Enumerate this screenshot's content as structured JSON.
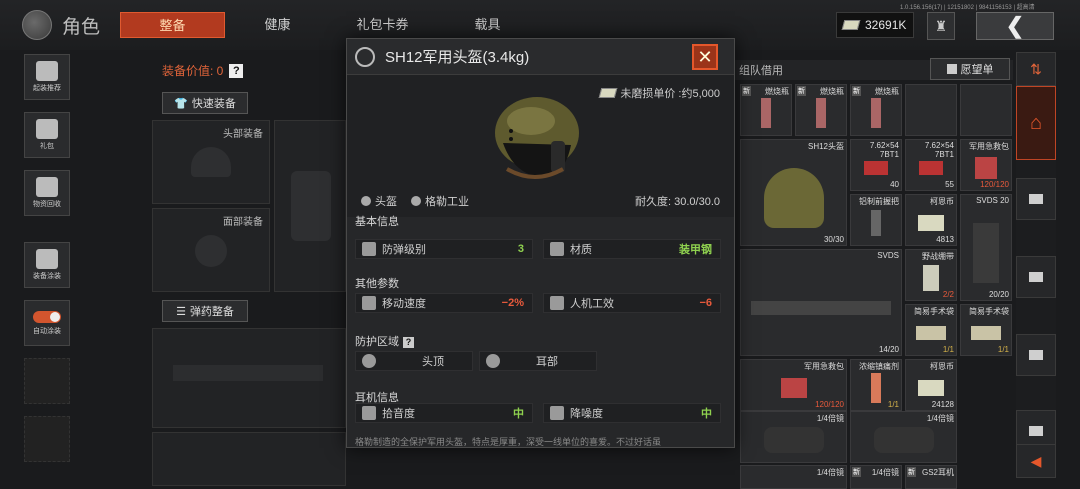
{
  "header": {
    "title": "角色",
    "tabs": [
      "整备",
      "健康",
      "礼包卡券",
      "载具"
    ],
    "version": "1.0.156.156(17) | 12151802 | 9841156153 | 超高清",
    "currency": "32691K"
  },
  "sidebar": {
    "items": [
      {
        "label": "起装推荐",
        "icon": "helmet-sparkle-icon"
      },
      {
        "label": "礼包",
        "icon": "gift-icon"
      },
      {
        "label": "物资回收",
        "icon": "recycle-icon"
      },
      {
        "label": "装备涂装",
        "icon": "spray-icon"
      },
      {
        "label": "自动涂装",
        "icon": "toggle-icon"
      }
    ]
  },
  "equipment": {
    "value_label": "装备价值: 0",
    "quick_label": "快速装备",
    "head_label": "头部装备",
    "face_label": "面部装备",
    "ammo_label": "弹药整备"
  },
  "modal": {
    "title": "SH12军用头盔(3.4kg)",
    "price": "未磨损单价 :约5,000",
    "tag_type": "头盔",
    "tag_maker": "格勒工业",
    "durability": "耐久度: 30.0/30.0",
    "section_basic": "基本信息",
    "armor_label": "防弹级别",
    "armor_value": "3",
    "material_label": "材质",
    "material_value": "装甲钢",
    "section_other": "其他参数",
    "speed_label": "移动速度",
    "speed_value": "−2%",
    "ergo_label": "人机工效",
    "ergo_value": "−6",
    "section_protect": "防护区域",
    "zone_head": "头顶",
    "zone_ear": "耳部",
    "section_earphone": "耳机信息",
    "pickup_label": "拾音度",
    "pickup_value": "中",
    "noise_label": "降噪度",
    "noise_value": "中",
    "description": "格勒制造的全保护军用头盔，特点是厚重，深受一线单位的喜爱。不过好话虽"
  },
  "stash": {
    "tab_label": "组队借用",
    "wish_label": "愿望单",
    "cells": [
      {
        "name": "燃烧瓶",
        "new": "新",
        "count": ""
      },
      {
        "name": "燃烧瓶",
        "new": "新",
        "count": ""
      },
      {
        "name": "燃烧瓶",
        "new": "新",
        "count": ""
      },
      {
        "name": "SH12头盔",
        "new": "",
        "count": "30/30"
      },
      {
        "name": "7.62×54",
        "sub": "7BT1",
        "new": "",
        "count": "40"
      },
      {
        "name": "7.62×54",
        "sub": "7BT1",
        "new": "",
        "count": "55"
      },
      {
        "name": "军用急救包",
        "new": "",
        "count": "120/120"
      },
      {
        "name": "铝制前握把",
        "new": "",
        "count": ""
      },
      {
        "name": "柯恩币",
        "new": "",
        "count": "4813"
      },
      {
        "name": "SVDS 20",
        "new": "",
        "count": "20/20"
      },
      {
        "name": "SVDS",
        "new": "",
        "count": "14/20"
      },
      {
        "name": "野战绷带",
        "new": "",
        "count": "2/2"
      },
      {
        "name": "简易手术袋",
        "new": "",
        "count": "1/1"
      },
      {
        "name": "简易手术袋",
        "new": "",
        "count": "1/1"
      },
      {
        "name": "军用急救包",
        "new": "",
        "count": "120/120"
      },
      {
        "name": "浓缩镇痛剂",
        "new": "",
        "count": "1/1"
      },
      {
        "name": "柯恩币",
        "new": "",
        "count": "24128"
      },
      {
        "name": "1/4倍镜",
        "new": "",
        "count": ""
      },
      {
        "name": "1/4倍镜",
        "new": "",
        "count": ""
      },
      {
        "name": "1/4倍镜",
        "new": "",
        "count": ""
      },
      {
        "name": "1/4倍镜",
        "new": "新",
        "count": ""
      },
      {
        "name": "GS2耳机",
        "new": "新",
        "count": ""
      }
    ]
  },
  "colors": {
    "accent": "#b23a1f",
    "green": "#8fd14f",
    "red": "#e85a3c"
  }
}
